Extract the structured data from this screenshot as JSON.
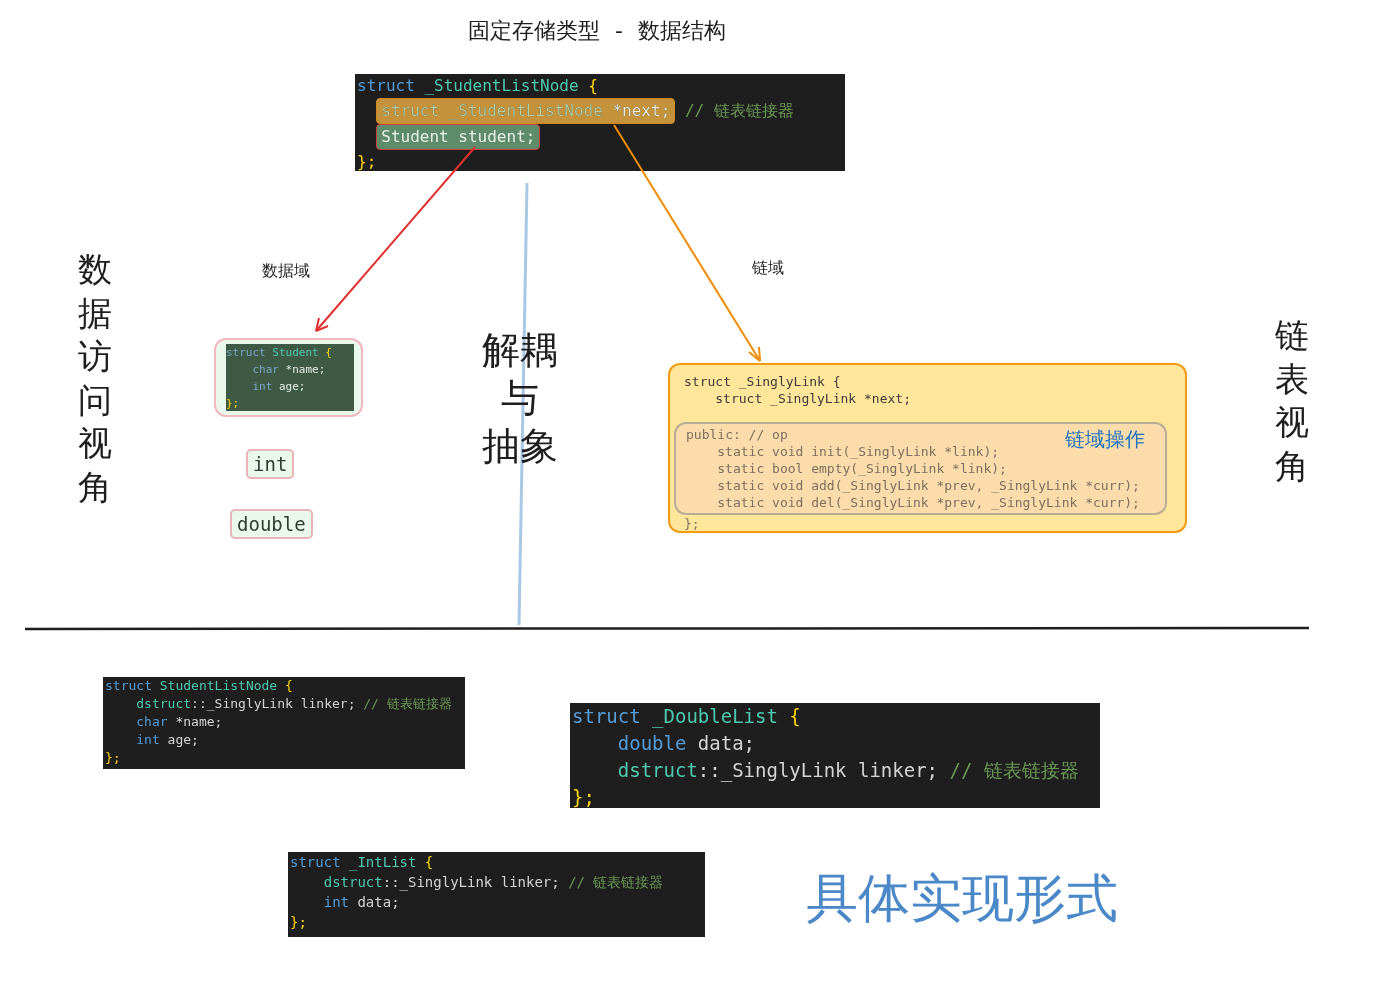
{
  "title": "固定存储类型 - 数据结构",
  "top_node": {
    "lines": [
      {
        "indented": false,
        "tokens": [
          {
            "text": "struct",
            "kind": "keyword"
          },
          {
            "text": " _StudentListNode",
            "kind": "type"
          },
          {
            "text": " {",
            "kind": "punct"
          }
        ]
      },
      {
        "indented": true,
        "color": "#c4923a",
        "tokens": [
          {
            "text": "struct",
            "kind": "keyword"
          },
          {
            "text": " _StudentListNode",
            "kind": "type"
          },
          {
            "text": " *next;",
            "kind": "plain"
          },
          {
            "text": " // 链表链接器",
            "kind": "comment"
          }
        ]
      },
      {
        "indented": true,
        "color": "#5e8c6a",
        "tokens": [
          {
            "text": "Student",
            "kind": "type"
          },
          {
            "text": " student;",
            "kind": "plain"
          }
        ]
      },
      {
        "indented": false,
        "tokens": [
          {
            "text": "};",
            "kind": "punct"
          }
        ]
      }
    ]
  },
  "data_field": {
    "label": "数据域",
    "node": {
      "lines": [
        {
          "indented": false,
          "tokens": [
            {
              "text": "struct",
              "kind": "keyword"
            },
            {
              "text": " Student",
              "kind": "type"
            },
            {
              "text": " {",
              "kind": "punct"
            }
          ]
        },
        {
          "indented": true,
          "tokens": [
            {
              "text": "char",
              "kind": "keyword"
            },
            {
              "text": " *name;",
              "kind": "plain"
            }
          ]
        },
        {
          "indented": true,
          "tokens": [
            {
              "text": "int",
              "kind": "keyword"
            },
            {
              "text": " age;",
              "kind": "plain"
            }
          ]
        },
        {
          "indented": false,
          "tokens": [
            {
              "text": "};",
              "kind": "punct"
            }
          ]
        }
      ]
    },
    "types": [
      "int",
      "double"
    ]
  },
  "link_field": {
    "label": "链域",
    "head_lines": [
      {
        "indented": false,
        "text": "struct _SinglyLink {"
      },
      {
        "indented": true,
        "text": "struct _SinglyLink *next;"
      }
    ],
    "ops": {
      "label": "链域操作",
      "lines": [
        {
          "indented": false,
          "text": "public: // op"
        },
        {
          "indented": true,
          "text": "static void init(_SinglyLink *link);"
        },
        {
          "indented": true,
          "text": "static bool empty(_SinglyLink *link);"
        },
        {
          "indented": true,
          "text": "static void add(_SinglyLink *prev, _SinglyLink *curr);"
        },
        {
          "indented": true,
          "text": "static void del(_SinglyLink *prev, _SinglyLink *curr);"
        }
      ]
    },
    "tail_lines": [
      {
        "indented": false,
        "text": "};"
      }
    ]
  },
  "center_label": [
    "解耦",
    "与",
    "抽象"
  ],
  "left_label": "数据访问视角",
  "right_label": "链表视角",
  "implementations": [
    {
      "lines": [
        {
          "indented": false,
          "tokens": [
            {
              "text": "struct",
              "kind": "keyword"
            },
            {
              "text": " StudentListNode",
              "kind": "type"
            },
            {
              "text": " {",
              "kind": "punct"
            }
          ]
        },
        {
          "indented": true,
          "tokens": [
            {
              "text": "dstruct",
              "kind": "type"
            },
            {
              "text": "::_SinglyLink linker;",
              "kind": "plain"
            },
            {
              "text": " // 链表链接器",
              "kind": "comment"
            }
          ]
        },
        {
          "indented": true,
          "tokens": [
            {
              "text": "char",
              "kind": "keyword"
            },
            {
              "text": " *name;",
              "kind": "plain"
            }
          ]
        },
        {
          "indented": true,
          "tokens": [
            {
              "text": "int",
              "kind": "keyword"
            },
            {
              "text": " age;",
              "kind": "plain"
            }
          ]
        },
        {
          "indented": false,
          "tokens": [
            {
              "text": "};",
              "kind": "punct"
            }
          ]
        }
      ]
    },
    {
      "lines": [
        {
          "indented": false,
          "tokens": [
            {
              "text": "struct",
              "kind": "keyword"
            },
            {
              "text": " _DoubleList",
              "kind": "type"
            },
            {
              "text": " {",
              "kind": "punct"
            }
          ]
        },
        {
          "indented": true,
          "tokens": [
            {
              "text": "double",
              "kind": "keyword"
            },
            {
              "text": " data;",
              "kind": "plain"
            }
          ]
        },
        {
          "indented": true,
          "tokens": [
            {
              "text": "dstruct",
              "kind": "type"
            },
            {
              "text": "::_SinglyLink linker;",
              "kind": "plain"
            },
            {
              "text": " // 链表链接器",
              "kind": "comment"
            }
          ]
        },
        {
          "indented": false,
          "tokens": [
            {
              "text": "};",
              "kind": "punct"
            }
          ]
        }
      ]
    },
    {
      "lines": [
        {
          "indented": false,
          "tokens": [
            {
              "text": "struct",
              "kind": "keyword"
            },
            {
              "text": " _IntList",
              "kind": "type"
            },
            {
              "text": " {",
              "kind": "punct"
            }
          ]
        },
        {
          "indented": true,
          "tokens": [
            {
              "text": "dstruct",
              "kind": "type"
            },
            {
              "text": "::_SinglyLink linker;",
              "kind": "plain"
            },
            {
              "text": " // 链表链接器",
              "kind": "comment"
            }
          ]
        },
        {
          "indented": true,
          "tokens": [
            {
              "text": "int",
              "kind": "keyword"
            },
            {
              "text": " data;",
              "kind": "plain"
            }
          ]
        },
        {
          "indented": false,
          "tokens": [
            {
              "text": "};",
              "kind": "punct"
            }
          ]
        }
      ]
    }
  ],
  "implementations_caption": "具体实现形式"
}
